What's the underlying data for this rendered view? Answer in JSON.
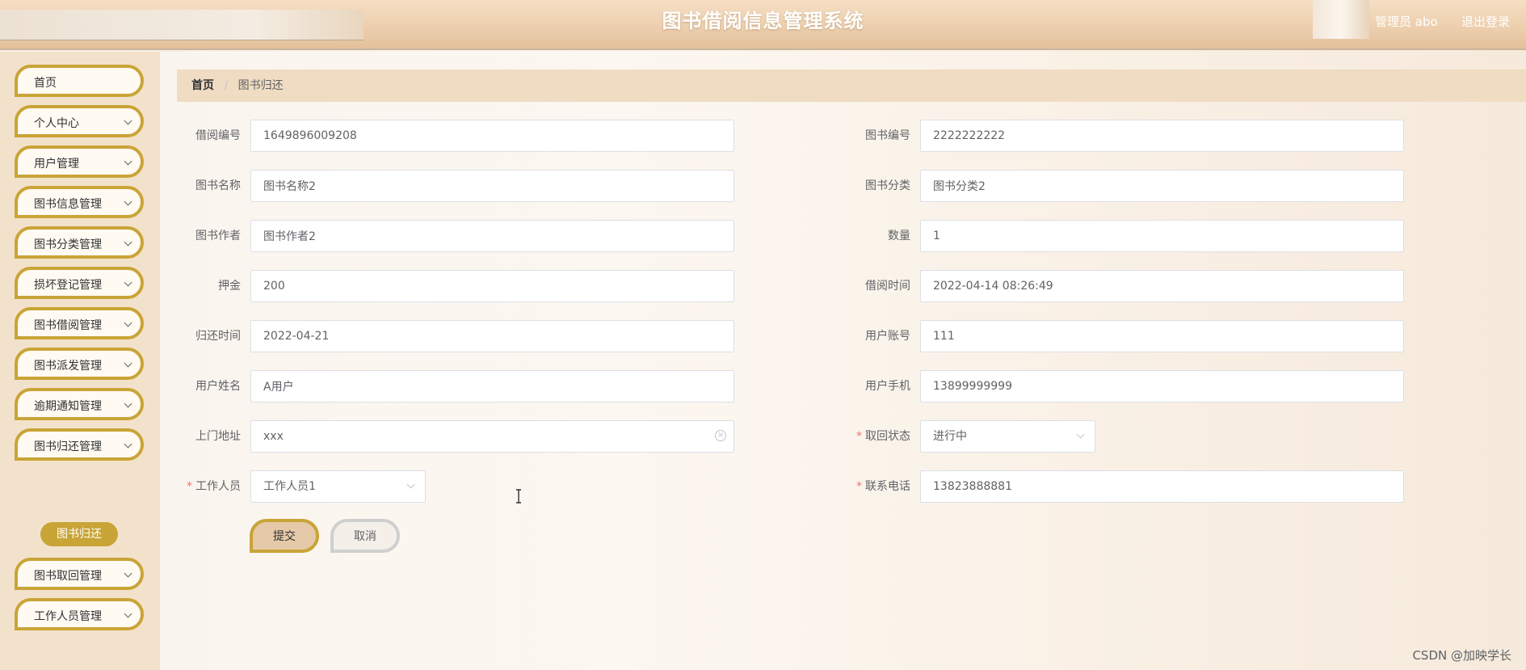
{
  "header": {
    "title": "图书借阅信息管理系统",
    "user": "管理员 abo",
    "logout": "退出登录"
  },
  "sidebar": {
    "items": [
      {
        "label": "首页",
        "expandable": false
      },
      {
        "label": "个人中心",
        "expandable": true
      },
      {
        "label": "用户管理",
        "expandable": true
      },
      {
        "label": "图书信息管理",
        "expandable": true
      },
      {
        "label": "图书分类管理",
        "expandable": true
      },
      {
        "label": "损坏登记管理",
        "expandable": true
      },
      {
        "label": "图书借阅管理",
        "expandable": true
      },
      {
        "label": "图书派发管理",
        "expandable": true
      },
      {
        "label": "逾期通知管理",
        "expandable": true
      },
      {
        "label": "图书归还管理",
        "expandable": true
      },
      {
        "label": "图书取回管理",
        "expandable": true
      },
      {
        "label": "工作人员管理",
        "expandable": true
      }
    ],
    "active_sub": "图书归还"
  },
  "breadcrumb": {
    "home": "首页",
    "separator": "/",
    "current": "图书归还"
  },
  "form": {
    "borrow_no": {
      "label": "借阅编号",
      "value": "1649896009208"
    },
    "book_no": {
      "label": "图书编号",
      "value": "2222222222"
    },
    "book_name": {
      "label": "图书名称",
      "value": "图书名称2"
    },
    "book_category": {
      "label": "图书分类",
      "value": "图书分类2"
    },
    "book_author": {
      "label": "图书作者",
      "value": "图书作者2"
    },
    "quantity": {
      "label": "数量",
      "value": "1"
    },
    "deposit": {
      "label": "押金",
      "value": "200"
    },
    "borrow_time": {
      "label": "借阅时间",
      "value": "2022-04-14 08:26:49"
    },
    "return_time": {
      "label": "归还时间",
      "value": "2022-04-21"
    },
    "user_account": {
      "label": "用户账号",
      "value": "111"
    },
    "user_name": {
      "label": "用户姓名",
      "value": "A用户"
    },
    "user_phone": {
      "label": "用户手机",
      "value": "13899999999"
    },
    "address": {
      "label": "上门地址",
      "value": "xxx"
    },
    "retrieve_status": {
      "label": "取回状态",
      "value": "进行中",
      "required": true
    },
    "staff": {
      "label": "工作人员",
      "value": "工作人员1",
      "required": true
    },
    "contact_phone": {
      "label": "联系电话",
      "value": "13823888881",
      "required": true
    },
    "required_mark": "*",
    "submit": "提交",
    "cancel": "取消"
  },
  "icons": {
    "clear": "circle-x-icon",
    "dropdown": "chevron-down-icon",
    "cursor": "text-cursor-icon"
  },
  "colors": {
    "accent": "#c9a437",
    "header_bg": "#edcfae",
    "sidebar_bg": "#f3e2cb",
    "breadcrumb_bg": "#efdcc2",
    "required": "#f56c6c"
  },
  "watermark": "CSDN @加映学长"
}
